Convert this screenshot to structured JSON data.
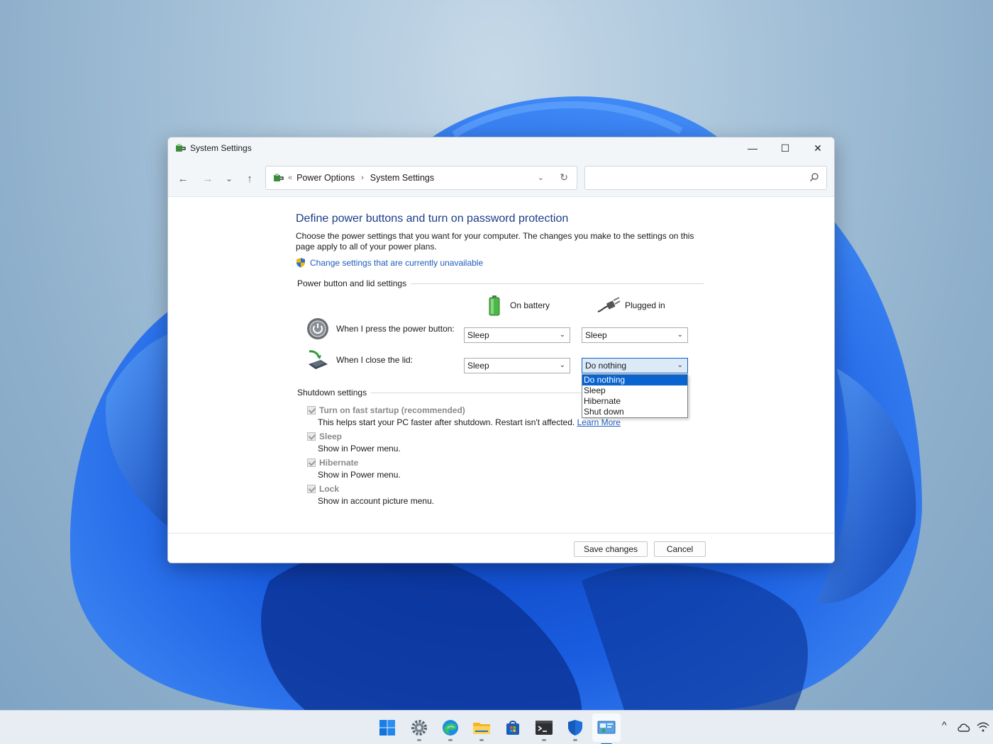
{
  "window": {
    "title": "System Settings",
    "controls": {
      "minimize": "—",
      "maximize": "☐",
      "close": "✕"
    }
  },
  "nav": {
    "back": "←",
    "forward": "→",
    "recent": "⌄",
    "up": "↑",
    "breadcrumb_prefix": "«",
    "breadcrumb": [
      "Power Options",
      "System Settings"
    ],
    "crumb_sep": "›",
    "dropdown": "⌄",
    "refresh": "↻",
    "search_placeholder": ""
  },
  "page": {
    "heading": "Define power buttons and turn on password protection",
    "description": "Choose the power settings that you want for your computer. The changes you make to the settings on this page apply to all of your power plans.",
    "uac_link": "Change settings that are currently unavailable"
  },
  "power_group": {
    "title": "Power button and lid settings",
    "col_battery": "On battery",
    "col_plugged": "Plugged in",
    "rows": [
      {
        "label": "When I press the power button:",
        "battery": "Sleep",
        "plugged": "Sleep"
      },
      {
        "label": "When I close the lid:",
        "battery": "Sleep",
        "plugged": "Do nothing"
      }
    ],
    "dropdown_options": [
      "Do nothing",
      "Sleep",
      "Hibernate",
      "Shut down"
    ],
    "dropdown_selected": "Do nothing",
    "arrow": "⌄"
  },
  "shutdown_group": {
    "title": "Shutdown settings",
    "items": [
      {
        "label": "Turn on fast startup (recommended)",
        "desc": "This helps start your PC faster after shutdown. Restart isn't affected.",
        "link": "Learn More",
        "checked": true
      },
      {
        "label": "Sleep",
        "desc": "Show in Power menu.",
        "checked": true
      },
      {
        "label": "Hibernate",
        "desc": "Show in Power menu.",
        "checked": true
      },
      {
        "label": "Lock",
        "desc": "Show in account picture menu.",
        "checked": true
      }
    ]
  },
  "footer": {
    "save": "Save changes",
    "cancel": "Cancel"
  },
  "taskbar": {
    "icons": [
      "start-icon",
      "settings-icon",
      "edge-icon",
      "file-explorer-icon",
      "store-icon",
      "terminal-icon",
      "security-icon",
      "control-panel-icon"
    ],
    "tray": {
      "chevron": "^"
    }
  },
  "colors": {
    "accent": "#0a64d0",
    "link": "#1e5dbd",
    "heading": "#1c3c88"
  }
}
